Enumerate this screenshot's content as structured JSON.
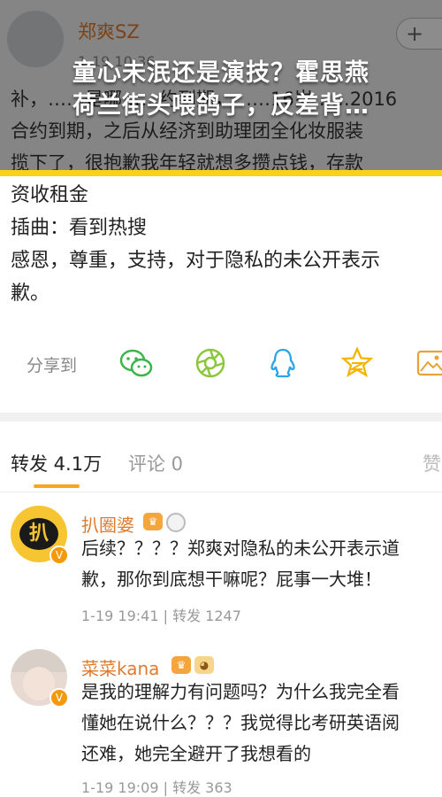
{
  "original_post": {
    "username": "郑爽SZ",
    "timestamp": "1-19 10:36",
    "follow_label": "+",
    "bg_lines": [
      "补，……是哪……约到期，……16岁……2016",
      "合约到期，之后从经济到助理团全化妆服装",
      "揽下了，很抱歉我年轻就想多攒点钱，存款"
    ]
  },
  "overlay": {
    "headline_line1": "童心未泯还是演技？霍思燕",
    "headline_line2": "荷兰街头喂鸽子，反差背…"
  },
  "post_body": {
    "lines": [
      "资收租金",
      "插曲：看到热搜",
      "感恩，尊重，支持，对于隐私的未公开表示",
      "歉。"
    ]
  },
  "share": {
    "label": "分享到",
    "icons": [
      "wechat-icon",
      "moments-icon",
      "qq-icon",
      "qzone-icon",
      "image-save-icon"
    ]
  },
  "tabs": {
    "forward": "转发 4.1万",
    "comment": "评论 0",
    "like": "赞"
  },
  "comments": [
    {
      "username": "扒圈婆",
      "avatar_text": "扒",
      "lines": [
        "后续？？？？郑爽对隐私的未公开表示道",
        "歉，那你到底想干嘛呢？屁事一大堆！"
      ],
      "meta": "1-19 19:41 | 转发 1247"
    },
    {
      "username": "菜菜kana",
      "lines": [
        "是我的理解力有问题吗？为什么我完全看",
        "懂她在说什么？？？我觉得比考研英语阅",
        "还难，她完全避开了我想看的"
      ],
      "meta": "1-19 19:09 | 转发 363"
    }
  ],
  "colors": {
    "accent": "#f5a623",
    "username": "#e07a2e",
    "highlight_bar": "#f6d21a"
  }
}
